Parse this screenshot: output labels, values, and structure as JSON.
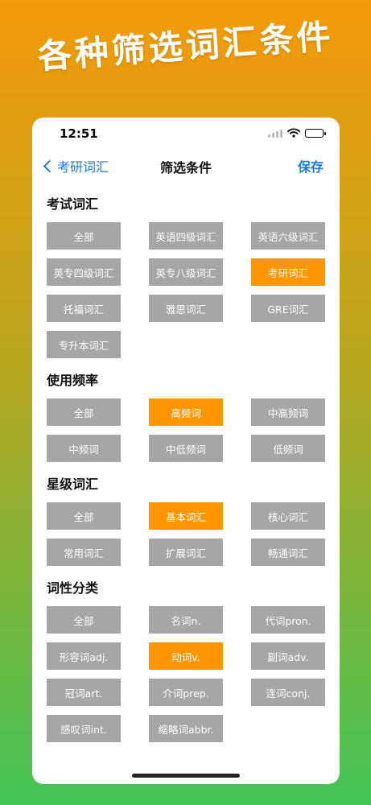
{
  "headline": "各种筛选词汇条件",
  "status_bar": {
    "time": "12:51"
  },
  "nav": {
    "back_label": "考研词汇",
    "title": "筛选条件",
    "save_label": "保存"
  },
  "colors": {
    "accent": "#ff9500",
    "chip": "#a6a6a6",
    "link": "#1a7be0"
  },
  "sections": [
    {
      "title": "考试词汇",
      "options": [
        {
          "label": "全部",
          "selected": false
        },
        {
          "label": "英语四级词汇",
          "selected": false
        },
        {
          "label": "英语六级词汇",
          "selected": false
        },
        {
          "label": "英专四级词汇",
          "selected": false
        },
        {
          "label": "英专八级词汇",
          "selected": false
        },
        {
          "label": "考研词汇",
          "selected": true
        },
        {
          "label": "托福词汇",
          "selected": false
        },
        {
          "label": "雅思词汇",
          "selected": false
        },
        {
          "label": "GRE词汇",
          "selected": false
        },
        {
          "label": "专升本词汇",
          "selected": false
        }
      ]
    },
    {
      "title": "使用频率",
      "options": [
        {
          "label": "全部",
          "selected": false
        },
        {
          "label": "高频词",
          "selected": true
        },
        {
          "label": "中高频词",
          "selected": false
        },
        {
          "label": "中频词",
          "selected": false
        },
        {
          "label": "中低频词",
          "selected": false
        },
        {
          "label": "低频词",
          "selected": false
        }
      ]
    },
    {
      "title": "星级词汇",
      "options": [
        {
          "label": "全部",
          "selected": false
        },
        {
          "label": "基本词汇",
          "selected": true
        },
        {
          "label": "核心词汇",
          "selected": false
        },
        {
          "label": "常用词汇",
          "selected": false
        },
        {
          "label": "扩展词汇",
          "selected": false
        },
        {
          "label": "畅通词汇",
          "selected": false
        }
      ]
    },
    {
      "title": "词性分类",
      "options": [
        {
          "label": "全部",
          "selected": false
        },
        {
          "label": "名词n.",
          "selected": false
        },
        {
          "label": "代词pron.",
          "selected": false
        },
        {
          "label": "形容词adj.",
          "selected": false
        },
        {
          "label": "动词v.",
          "selected": true
        },
        {
          "label": "副词adv.",
          "selected": false
        },
        {
          "label": "冠词art.",
          "selected": false
        },
        {
          "label": "介词prep.",
          "selected": false
        },
        {
          "label": "连词conj.",
          "selected": false
        },
        {
          "label": "感叹词int.",
          "selected": false
        },
        {
          "label": "缩略词abbr.",
          "selected": false
        }
      ]
    }
  ]
}
